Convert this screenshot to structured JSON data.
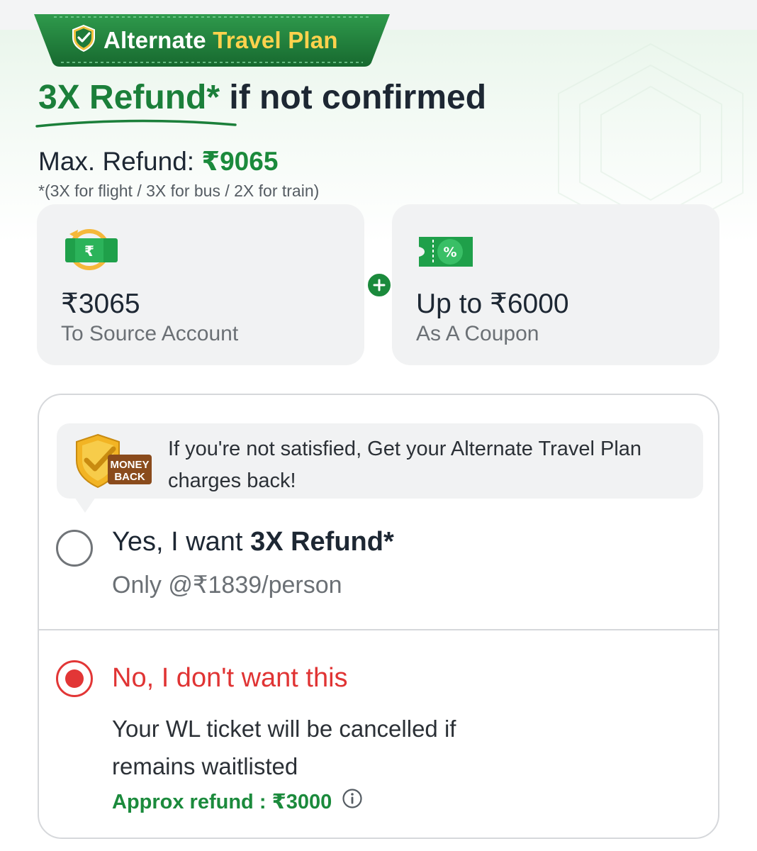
{
  "banner": {
    "title_part1": "Alternate",
    "title_part2": "Travel Plan",
    "icon": "shield-check-icon"
  },
  "headline": {
    "green": "3X Refund*",
    "rest": "if not confirmed"
  },
  "max_refund": {
    "label": "Max. Refund:",
    "amount": "₹9065",
    "note": "*(3X for flight / 3X for bus / 2X for train)"
  },
  "cards": [
    {
      "amount": "₹3065",
      "subtitle": "To Source Account",
      "icon": "rupee-refund-icon"
    },
    {
      "amount": "Up to ₹6000",
      "subtitle": "As A Coupon",
      "icon": "coupon-ticket-icon"
    }
  ],
  "plus_icon": "plus-icon",
  "money_back": {
    "badge_line1": "MONEY",
    "badge_line2": "BACK",
    "text": "If you're not satisfied, Get your Alternate Travel Plan charges back!"
  },
  "options": {
    "yes": {
      "prefix": "Yes, I want",
      "bold": "3X Refund*",
      "subtitle": "Only @₹1839/person",
      "selected": false
    },
    "no": {
      "title": "No, I don't want this",
      "description": "Your WL ticket will be cancelled if remains waitlisted",
      "approx_label": "Approx refund :",
      "approx_amount": "₹3000",
      "info_icon": "info-icon",
      "selected": true
    }
  },
  "colors": {
    "brand_green": "#1b8a3c",
    "banner_green": "#1f7a3a",
    "accent_yellow": "#ffd24d",
    "selected_red": "#e23636"
  }
}
